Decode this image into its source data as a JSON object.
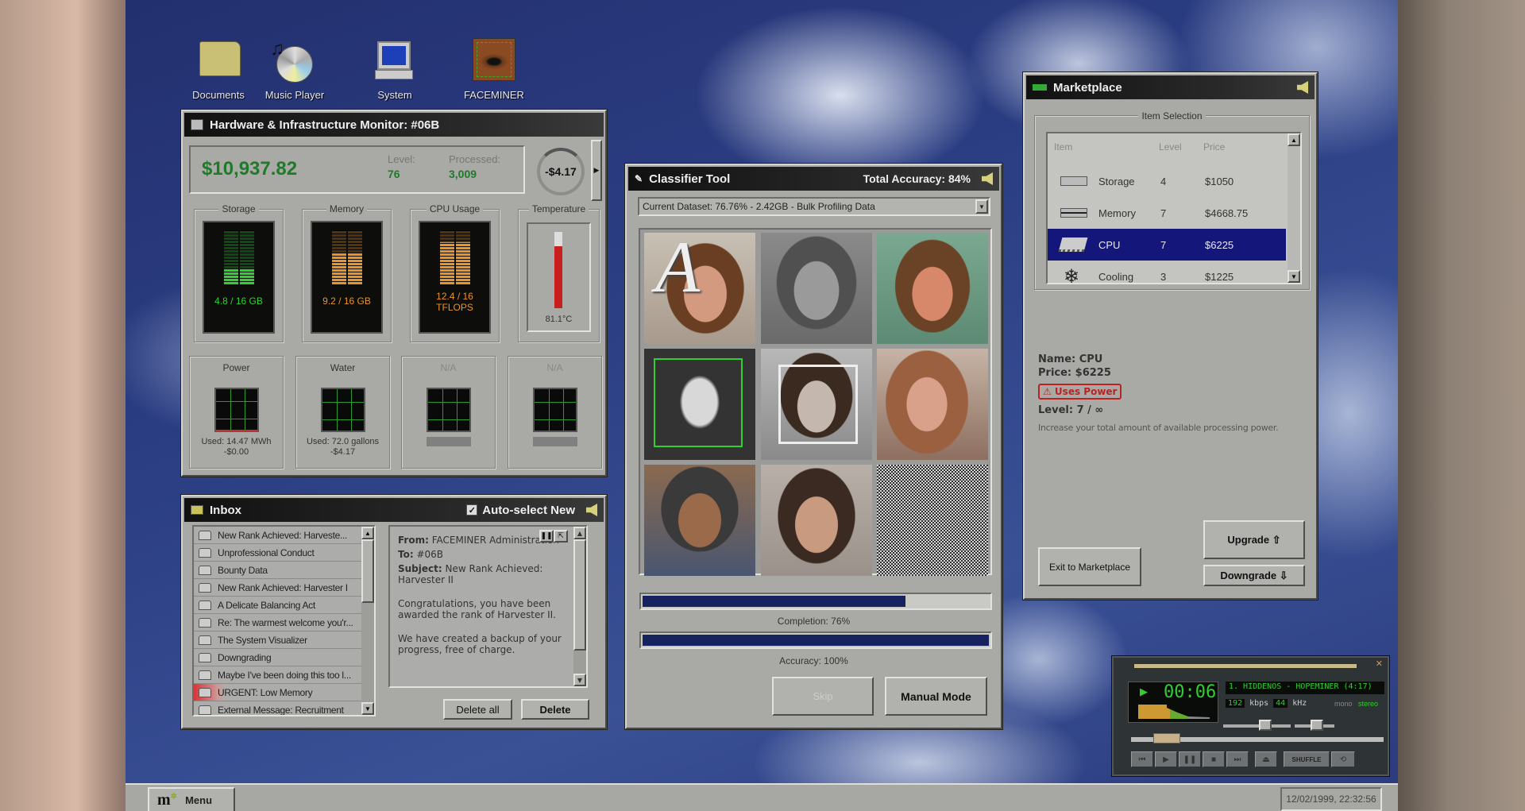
{
  "desktop": {
    "icons": [
      {
        "label": "Documents",
        "icon": "folder-icon"
      },
      {
        "label": "Music Player",
        "icon": "cd-icon"
      },
      {
        "label": "System",
        "icon": "computer-icon"
      },
      {
        "label": "FACEMINER",
        "icon": "eye-icon"
      }
    ]
  },
  "hardware": {
    "title": "Hardware & Infrastructure Monitor: #06B",
    "balance": "$10,937.82",
    "level_label": "Level:",
    "level": "76",
    "processed_label": "Processed:",
    "processed": "3,009",
    "rate": "-$4.17",
    "storage": {
      "label": "Storage",
      "value": "4.8 / 16 GB",
      "fill": 0.3,
      "color": "#2fd02f"
    },
    "memory": {
      "label": "Memory",
      "value": "9.2 / 16 GB",
      "fill": 0.575,
      "color": "#e8942a"
    },
    "cpu": {
      "label": "CPU Usage",
      "value_line1": "12.4 / 16",
      "value_line2": "TFLOPS",
      "fill": 0.775,
      "color": "#e8942a"
    },
    "temperature": {
      "label": "Temperature",
      "value": "81.1°C",
      "fill": 0.81
    },
    "power": {
      "label": "Power",
      "used": "Used: 14.47 MWh",
      "cost": "-$0.00"
    },
    "water": {
      "label": "Water",
      "used": "Used: 72.0 gallons",
      "cost": "-$4.17"
    },
    "na1": {
      "label": "N/A"
    },
    "na2": {
      "label": "N/A"
    }
  },
  "inbox": {
    "title": "Inbox",
    "auto_select_label": "Auto-select New",
    "auto_select_checked": true,
    "messages": [
      "New Rank Achieved: Harveste...",
      "Unprofessional Conduct",
      "Bounty Data",
      "New Rank Achieved: Harvester I",
      "A Delicate Balancing Act",
      "Re: The warmest welcome you'r...",
      "The System Visualizer",
      "Downgrading",
      "Maybe I've been doing this too l...",
      "URGENT: Low Memory",
      "External Message: Recruitment"
    ],
    "preview": {
      "from_label": "From:",
      "from": "FACEMINER Administration",
      "to_label": "To:",
      "to": "#06B",
      "subject_label": "Subject:",
      "subject": "New Rank Achieved: Harvester II",
      "body1": "Congratulations, you have been awarded the rank of Harvester II.",
      "body2": "We have created a backup of your progress, free of charge."
    },
    "delete_all": "Delete all",
    "delete": "Delete"
  },
  "classifier": {
    "title": "Classifier Tool",
    "total_accuracy": "Total Accuracy: 84%",
    "dataset": "Current Dataset: 76.76% - 2.42GB - Bulk Profiling Data",
    "overlay_letter": "A",
    "completion_label": "Completion: 76%",
    "completion": 0.76,
    "accuracy_label": "Accuracy: 100%",
    "accuracy": 1.0,
    "skip": "Skip",
    "manual_mode": "Manual Mode"
  },
  "marketplace": {
    "title": "Marketplace",
    "group_label": "Item Selection",
    "columns": [
      "Item",
      "Level",
      "Price"
    ],
    "items": [
      {
        "name": "Storage",
        "level": "4",
        "price": "$1050",
        "icon": "drive-icon"
      },
      {
        "name": "Memory",
        "level": "7",
        "price": "$4668.75",
        "icon": "memory-icon"
      },
      {
        "name": "CPU",
        "level": "7",
        "price": "$6225",
        "icon": "chip-icon",
        "selected": true
      },
      {
        "name": "Cooling",
        "level": "3",
        "price": "$1225",
        "icon": "snowflake-icon"
      }
    ],
    "detail": {
      "name": "Name: CPU",
      "price": "Price: $6225",
      "warning": "⚠ Uses Power",
      "level": "Level: 7 / ∞",
      "description": "Increase your total amount of available processing power."
    },
    "exit": "Exit to Marketplace",
    "upgrade": "Upgrade ⇧",
    "downgrade": "Downgrade ⇩",
    "selection_color": "#14167a"
  },
  "music": {
    "time": "00:06",
    "track": "1. HIDDENOS - HOPEMINER (4:17)",
    "kbps": "192",
    "kbps_label": "kbps",
    "khz": "44",
    "khz_label": "kHz",
    "mono": "mono",
    "stereo": "stereo",
    "shuffle": "SHUFFLE",
    "position": 0.1
  },
  "taskbar": {
    "menu": "Menu",
    "clock": "12/02/1999, 22:32:56"
  }
}
